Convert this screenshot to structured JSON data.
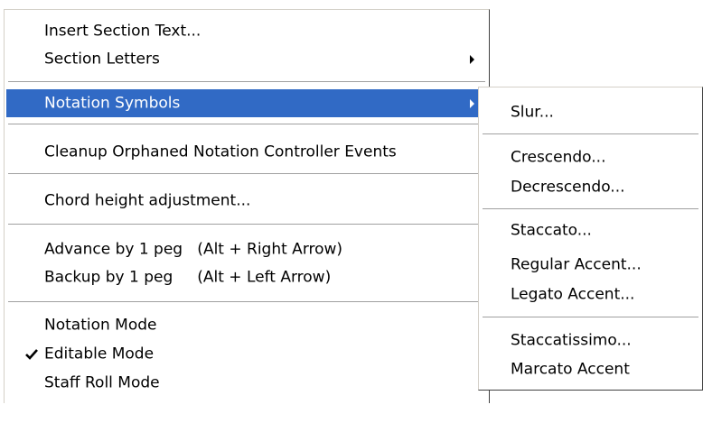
{
  "main_menu": {
    "insert_section_text": "Insert Section Text...",
    "section_letters": "Section Letters",
    "notation_symbols": "Notation Symbols",
    "cleanup_orphaned": "Cleanup Orphaned Notation Controller Events",
    "chord_height": "Chord height adjustment...",
    "advance_peg": "Advance by 1 peg   (Alt + Right Arrow)",
    "backup_peg": "Backup by 1 peg     (Alt + Left Arrow)",
    "notation_mode": "Notation Mode",
    "editable_mode": "Editable Mode",
    "staff_roll_mode": "Staff Roll Mode"
  },
  "submenu": {
    "slur": "Slur...",
    "crescendo": "Crescendo...",
    "decrescendo": "Decrescendo...",
    "staccato": "Staccato...",
    "regular_accent": "Regular Accent...",
    "legato_accent": "Legato Accent...",
    "staccatissimo": "Staccatissimo...",
    "marcato_accent": "Marcato Accent"
  },
  "icons": {
    "submenu_arrow": "chevron-right-icon",
    "checked": "checkmark-icon"
  },
  "colors": {
    "highlight_bg": "#316ac5",
    "highlight_text": "#ffffff",
    "menu_bg": "#ffffff"
  }
}
